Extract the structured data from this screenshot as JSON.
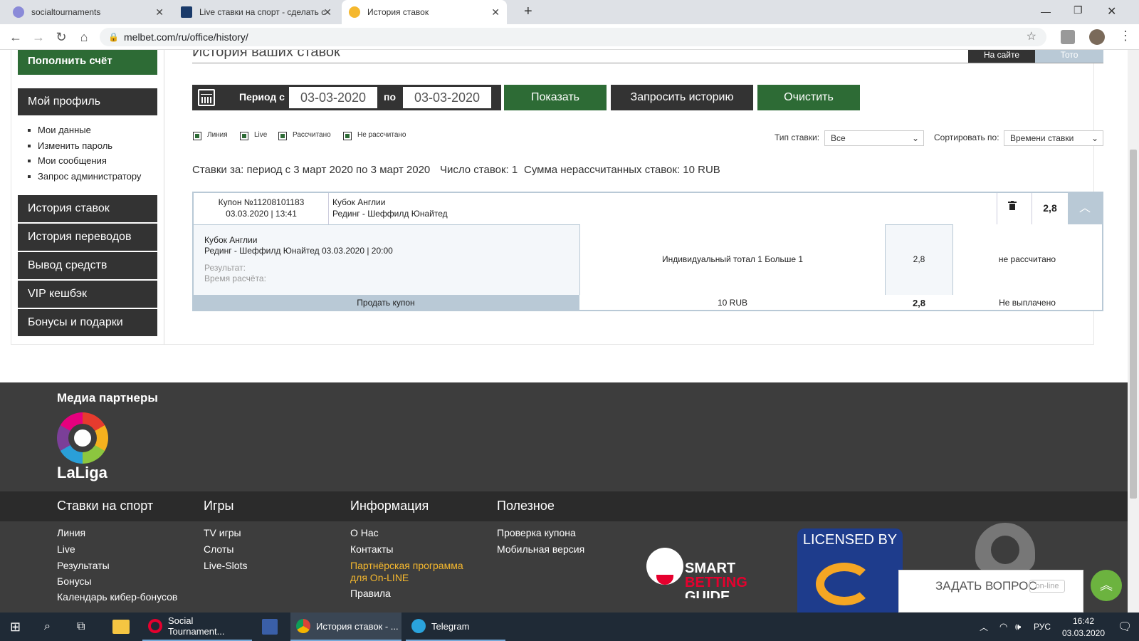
{
  "browser": {
    "tabs": [
      {
        "title": "socialtournaments",
        "favicon_color": "#8a8ad8"
      },
      {
        "title": "Live ставки на спорт - сделать с",
        "favicon_color": "#1a3a6a"
      },
      {
        "title": "История ставок",
        "favicon_color": "#f5b82e"
      }
    ],
    "url": "melbet.com/ru/office/history/"
  },
  "sidebar": {
    "deposit": "Пополнить счёт",
    "profile": "Мой профиль",
    "profile_links": [
      "Мои данные",
      "Изменить пароль",
      "Мои сообщения",
      "Запрос администратору"
    ],
    "menu": [
      "История ставок",
      "История переводов",
      "Вывод средств",
      "VIP кешбэк",
      "Бонусы и подарки"
    ]
  },
  "main": {
    "title": "История ваших ставок",
    "tabs": [
      "На сайте",
      "Тото"
    ],
    "filter": {
      "period_from_label": "Период с",
      "date_from": "03-03-2020",
      "to_label": "по",
      "date_to": "03-03-2020",
      "show": "Показать",
      "request": "Запросить историю",
      "clear": "Очистить"
    },
    "checkboxes": [
      "Линия",
      "Live",
      "Рассчитано",
      "Не рассчитано"
    ],
    "bet_type_label": "Тип ставки:",
    "bet_type_value": "Все",
    "sort_label": "Сортировать по:",
    "sort_value": "Времени ставки",
    "summary": {
      "period": "Ставки за: период с 3 март 2020 по 3 март 2020",
      "count": "Число ставок: 1",
      "unsettled": "Сумма нерассчитанных ставок: 10 RUB"
    },
    "coupon": {
      "number": "Купон №11208101183",
      "datetime": "03.03.2020 | 13:41",
      "league": "Кубок Англии",
      "match": "Рединг - Шеффилд Юнайтед",
      "odds": "2,8",
      "detail_league": "Кубок Англии",
      "detail_match": "Рединг - Шеффилд Юнайтед 03.03.2020 | 20:00",
      "result_label": "Результат:",
      "calc_time_label": "Время расчёта:",
      "bet": "Индивидуальный тотал 1 Больше 1",
      "detail_odds": "2,8",
      "status": "не рассчитано",
      "sell": "Продать купон",
      "stake": "10 RUB",
      "total_odds": "2,8",
      "payout": "Не выплачено"
    }
  },
  "footer": {
    "media_partners": "Медиа партнеры",
    "laliga": "LaLiga",
    "cols": [
      {
        "head": "Ставки на спорт",
        "links": [
          "Линия",
          "Live",
          "Результаты",
          "Бонусы",
          "Календарь кибер-бонусов"
        ]
      },
      {
        "head": "Игры",
        "links": [
          "TV игры",
          "Слоты",
          "Live-Slots"
        ]
      },
      {
        "head": "Информация",
        "links": [
          "О Нас",
          "Контакты",
          "Партнёрская программа",
          "для On-LINE",
          "Правила"
        ]
      },
      {
        "head": "Полезное",
        "links": [
          "Проверка купона",
          "Мобильная версия"
        ]
      }
    ],
    "smart": "SMART",
    "betting": "BETTING",
    "guide": "GUIDE",
    "licensed": "LICENSED BY",
    "ask": "ЗАДАТЬ ВОПРОС",
    "online": "on-line"
  },
  "taskbar": {
    "apps": [
      "Social Tournament...",
      "История ставок - ...",
      "Telegram"
    ],
    "lang": "РУС",
    "time": "16:42",
    "date": "03.03.2020"
  }
}
